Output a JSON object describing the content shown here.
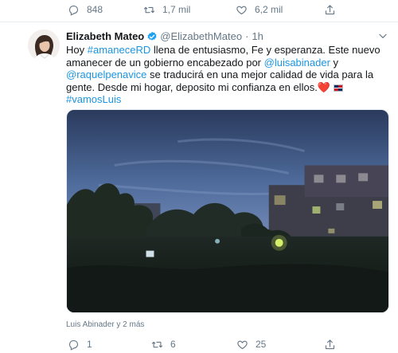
{
  "prev_tweet_actions": {
    "reply_count": "848",
    "retweet_count": "1,7 mil",
    "like_count": "6,2 mil"
  },
  "tweet": {
    "display_name": "Elizabeth Mateo",
    "handle": "@ElizabethMateo",
    "separator": "·",
    "time": "1h",
    "text": {
      "p1": "Hoy ",
      "hashtag1": "#amaneceRD",
      "p2": " llena de entusiasmo, Fe y esperanza. Este nuevo amanecer de un gobierno encabezado por ",
      "mention1": "@luisabinader",
      "p3": " y ",
      "mention2": "@raquelpenavice",
      "p4": " se traducirá en una mejor calidad de vida para la gente. Desde mi hogar, deposito mi confianza en ellos.",
      "hashtag2": "#vamosLuis"
    },
    "emoji": {
      "heart": "❤️"
    },
    "liked_by": "Luis Abinader y 2 más",
    "actions": {
      "reply_count": "1",
      "retweet_count": "6",
      "like_count": "25"
    }
  },
  "colors": {
    "link": "#1b95e0",
    "muted": "#657786",
    "verified": "#1da1f2",
    "heart": "#e0245e",
    "divider": "#e6ecf0"
  },
  "icons": {
    "reply": "reply-icon",
    "retweet": "retweet-icon",
    "like": "like-icon",
    "share": "share-icon",
    "verified": "verified-badge-icon",
    "caret": "chevron-down-icon"
  }
}
